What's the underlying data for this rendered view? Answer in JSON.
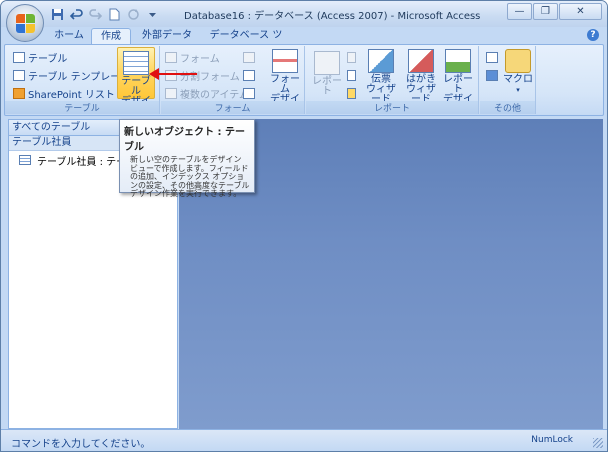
{
  "window": {
    "title": "Database16 : データベース (Access 2007) - Microsoft Access"
  },
  "quick_access": {
    "icons": [
      "save-icon",
      "undo-icon",
      "redo-icon",
      "new-icon",
      "refresh-icon",
      "customize-icon"
    ]
  },
  "window_buttons": {
    "minimize": "—",
    "restore": "❐",
    "close": "✕"
  },
  "tabs": [
    {
      "label": "ホーム",
      "active": false
    },
    {
      "label": "作成",
      "active": true
    },
    {
      "label": "外部データ",
      "active": false
    },
    {
      "label": "データベース ツール",
      "active": false
    }
  ],
  "help_label": "?",
  "ribbon": {
    "groups": {
      "table": {
        "label": "テーブル",
        "items": [
          "テーブル",
          "テーブル テンプレート ▾",
          "SharePoint リスト ▾"
        ],
        "big_button": {
          "line1": "テーブル",
          "line2": "デザイン"
        }
      },
      "form": {
        "label": "フォーム",
        "items": [
          "フォーム",
          "分割フォーム",
          "複数のアイテム"
        ],
        "big_button": {
          "line1": "フォーム",
          "line2": "デザイン"
        }
      },
      "report": {
        "label": "レポート",
        "big_report": "レポート",
        "labels_wizard": {
          "line1": "伝票",
          "line2": "ウィザード"
        },
        "postcard_wizard": {
          "line1": "はがき",
          "line2": "ウィザード"
        },
        "report_design": {
          "line1": "レポート",
          "line2": "デザイン"
        }
      },
      "other": {
        "label": "その他",
        "macro": {
          "line1": "マクロ",
          "line2": "▾"
        }
      }
    }
  },
  "navigation": {
    "header": "すべてのテーブル",
    "header_chevron": "«",
    "group_label": "テーブル社員",
    "group_chevron": "≈",
    "items": [
      {
        "label": "テーブル社員 : テーブル"
      }
    ]
  },
  "tooltip": {
    "title": "新しいオブジェクト : テーブル",
    "body": "新しい空のテーブルをデザイン ビューで作成します。フィールドの追加、インデックス オプションの設定、その他高度なテーブル デザイン作業を実行できます。"
  },
  "status": {
    "left": "コマンドを入力してください。",
    "right": "NumLock"
  },
  "colors": {
    "accent": "#15428b",
    "workspace": "#6f8ec4",
    "highlight": "#ffd764",
    "arrow": "#e01010"
  }
}
